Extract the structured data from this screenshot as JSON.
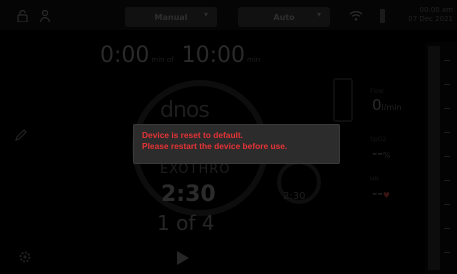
{
  "header": {
    "mode_manual": "Manual",
    "mode_auto": "Auto",
    "clock_time": "00:00 am",
    "clock_date": "07 Dec 2021",
    "icons": [
      "unlock-icon",
      "user-icon",
      "wifi-icon",
      "battery-icon",
      "chevron-down-icon"
    ]
  },
  "timer": {
    "elapsed": "0:00",
    "elapsed_unit": "min of",
    "total": "10:00",
    "total_unit": "min"
  },
  "program": {
    "logo": "dnos",
    "step_name": "EXOTHRO",
    "step_time": "2:30",
    "step_count": "1 of 4",
    "small_time": "2:30"
  },
  "stats": {
    "stat1_label": "Flow",
    "stat1_value": "0",
    "stat1_unit": "l/min",
    "stat2_label": "SpO2",
    "stat2_value": "--",
    "stat2_unit": "%",
    "stat3_label": "HR",
    "stat3_value": "--",
    "stat3_unit": "♥"
  },
  "alert": {
    "line1": "Device is reset to default.",
    "line2": "Please restart the device before use.",
    "color": "#e63336"
  },
  "colors": {
    "background": "#000000",
    "dialog": "#2c2c2c"
  }
}
